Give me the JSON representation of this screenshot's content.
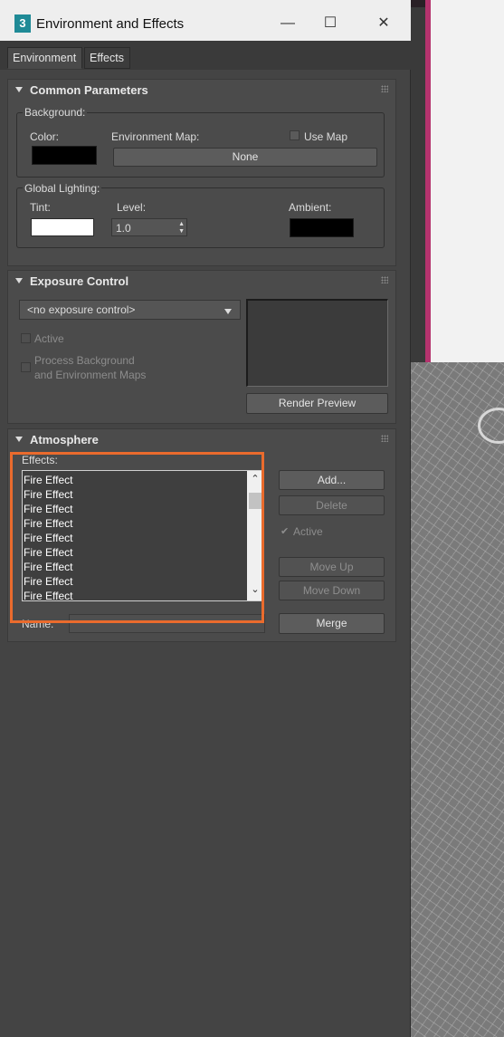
{
  "window": {
    "title": "Environment and Effects",
    "app_icon_text": "3",
    "controls": {
      "minimize": "—",
      "maximize": "☐",
      "close": "✕"
    }
  },
  "tabs": [
    {
      "label": "Environment",
      "active": true
    },
    {
      "label": "Effects",
      "active": false
    }
  ],
  "common_parameters": {
    "title": "Common Parameters",
    "background": {
      "group_label": "Background:",
      "color_label": "Color:",
      "color_value": "#000000",
      "env_map_label": "Environment Map:",
      "use_map_label": "Use Map",
      "use_map_checked": false,
      "env_map_button": "None"
    },
    "global_lighting": {
      "group_label": "Global Lighting:",
      "tint_label": "Tint:",
      "tint_value": "#ffffff",
      "level_label": "Level:",
      "level_value": "1.0",
      "ambient_label": "Ambient:",
      "ambient_value": "#000000"
    }
  },
  "exposure_control": {
    "title": "Exposure Control",
    "selected": "<no exposure control>",
    "active_label": "Active",
    "active_checked": false,
    "process_bg_label_line1": "Process Background",
    "process_bg_label_line2": "and Environment Maps",
    "process_bg_checked": false,
    "render_preview_button": "Render Preview"
  },
  "atmosphere": {
    "title": "Atmosphere",
    "effects_label": "Effects:",
    "effects": [
      "Fire Effect",
      "Fire Effect",
      "Fire Effect",
      "Fire Effect",
      "Fire Effect",
      "Fire Effect",
      "Fire Effect",
      "Fire Effect",
      "Fire Effect"
    ],
    "add_button": "Add...",
    "delete_button": "Delete",
    "active_label": "Active",
    "active_checked": true,
    "move_up_button": "Move Up",
    "move_down_button": "Move Down",
    "name_label": "Name:",
    "name_value": "",
    "merge_button": "Merge"
  },
  "colors": {
    "highlight": "#ea6b2d",
    "panel": "#4b4b4b"
  }
}
